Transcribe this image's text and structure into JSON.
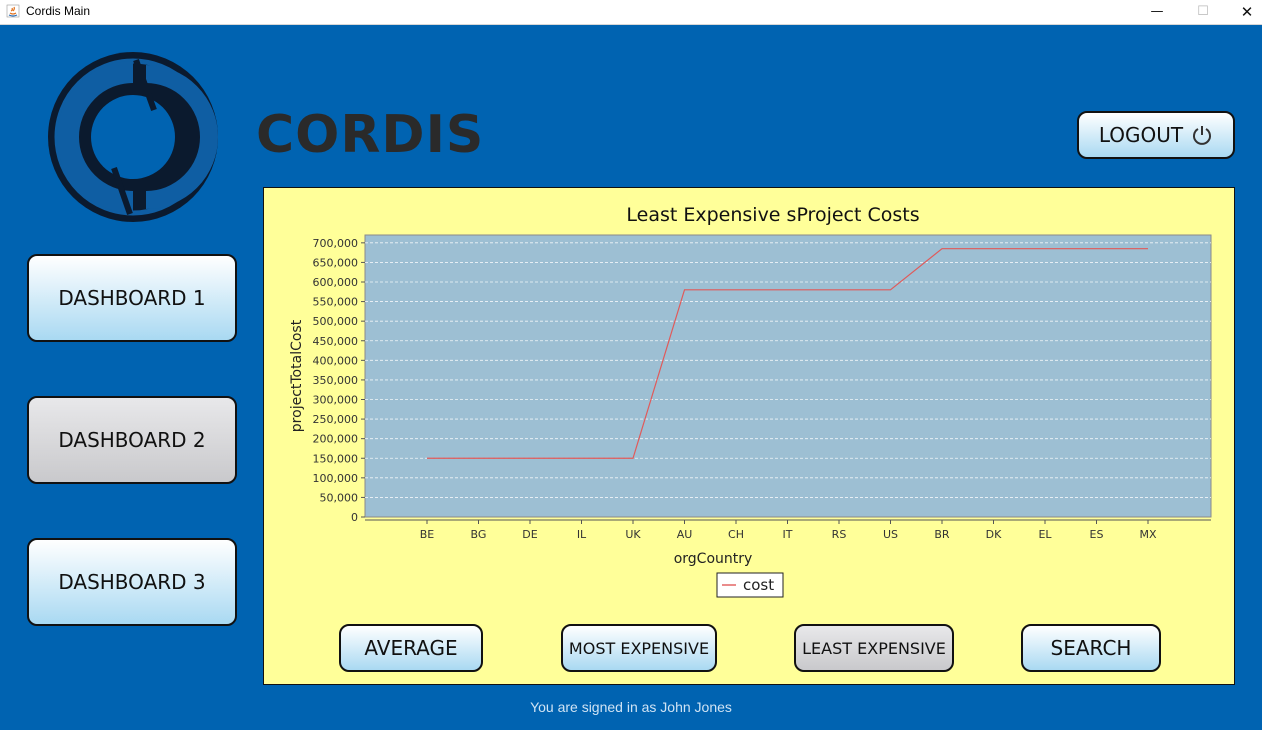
{
  "window": {
    "title": "Cordis Main",
    "controls": {
      "minimize": "—",
      "maximize": "☐",
      "close": "✕"
    }
  },
  "brand": {
    "name": "CORDIS"
  },
  "header": {
    "logout_label": "LOGOUT"
  },
  "sidebar": {
    "items": [
      {
        "label": "DASHBOARD 1"
      },
      {
        "label": "DASHBOARD 2"
      },
      {
        "label": "DASHBOARD 3"
      }
    ]
  },
  "actions": {
    "average_label": "AVERAGE",
    "most_expensive_label": "MOST EXPENSIVE",
    "least_expensive_label": "LEAST EXPENSIVE",
    "search_label": "SEARCH"
  },
  "footer": {
    "signed_in_text": "You are signed in as John Jones"
  },
  "colors": {
    "background": "#0063b1",
    "panel": "#ffff99",
    "plot_area": "#9dbfd3",
    "series": "#e05a5a",
    "button_gradient_end": "#a9d9f2",
    "button_selected": "#c9c9cc"
  },
  "chart_data": {
    "type": "line",
    "title": "Least Expensive sProject Costs",
    "xlabel": "orgCountry",
    "ylabel": "projectTotalCost",
    "categories": [
      "BE",
      "BG",
      "DE",
      "IL",
      "UK",
      "AU",
      "CH",
      "IT",
      "RS",
      "US",
      "BR",
      "DK",
      "EL",
      "ES",
      "MX"
    ],
    "series": [
      {
        "name": "cost",
        "values": [
          150000,
          150000,
          150000,
          150000,
          150000,
          580000,
          580000,
          580000,
          580000,
          580000,
          685000,
          685000,
          685000,
          685000,
          685000
        ]
      }
    ],
    "ylim": [
      0,
      720000
    ],
    "yticks": [
      0,
      50000,
      100000,
      150000,
      200000,
      250000,
      300000,
      350000,
      400000,
      450000,
      500000,
      550000,
      600000,
      650000,
      700000
    ],
    "ytick_labels": [
      "0",
      "50,000",
      "100,000",
      "150,000",
      "200,000",
      "250,000",
      "300,000",
      "350,000",
      "400,000",
      "450,000",
      "500,000",
      "550,000",
      "600,000",
      "650,000",
      "700,000"
    ],
    "grid": true,
    "legend": "bottom-center"
  }
}
